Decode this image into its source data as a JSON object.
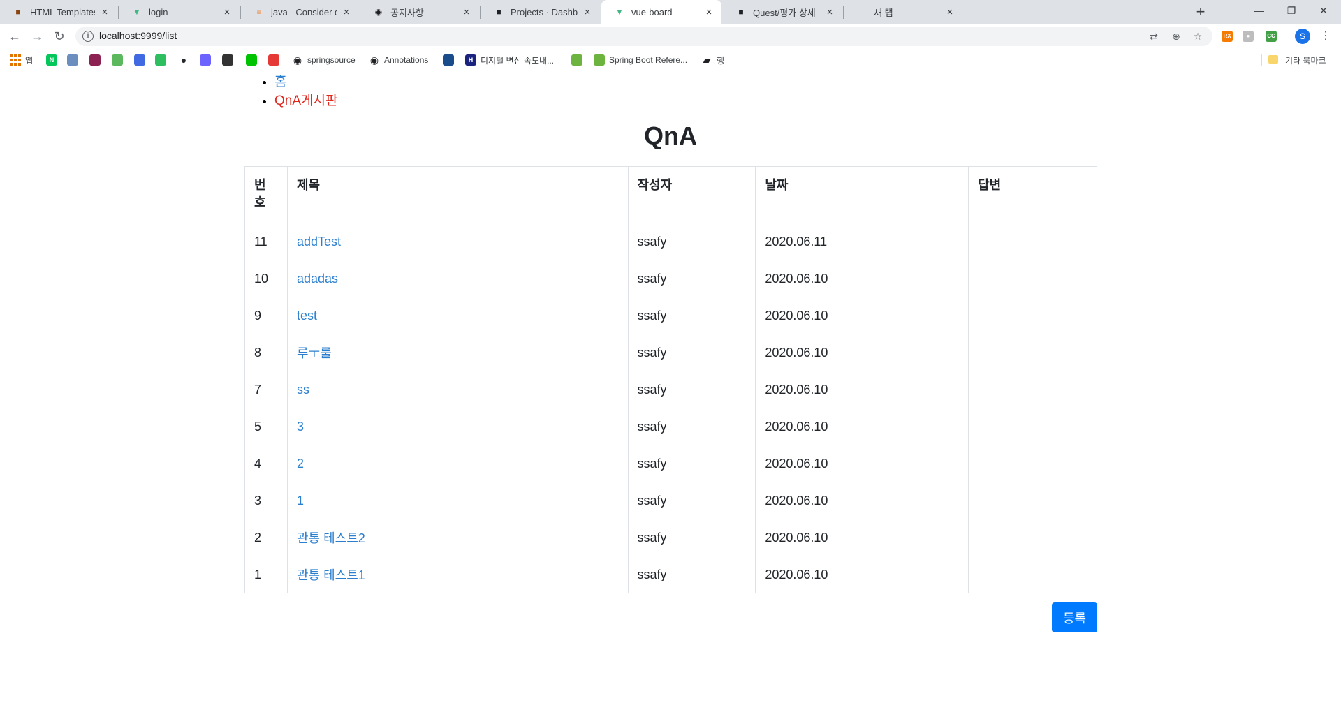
{
  "browser": {
    "tabs": [
      {
        "title": "HTML Templates - HTML W",
        "icon": "html-templates-favicon",
        "icon_color": "#8b4513"
      },
      {
        "title": "login",
        "icon": "vue-favicon",
        "icon_color": "#41b883"
      },
      {
        "title": "java - Consider defining a",
        "icon": "stackoverflow-favicon",
        "icon_color": "#f48024"
      },
      {
        "title": "공지사항",
        "icon": "globe-favicon",
        "icon_color": "#202124"
      },
      {
        "title": "Projects · Dashboard · GitL",
        "icon": "gitlab-favicon",
        "icon_color": "#202124"
      },
      {
        "title": "vue-board",
        "icon": "vue-favicon",
        "icon_color": "#41b883"
      },
      {
        "title": "Quest/평가 상세",
        "icon": "quest-favicon",
        "icon_color": "#202124"
      },
      {
        "title": "새 탭",
        "icon": "blank-favicon",
        "icon_color": "#5f6368"
      }
    ],
    "active_tab_index": 5,
    "url": "localhost:9999/list",
    "profile_initial": "S",
    "bookmarks": [
      {
        "label": "앱",
        "icon": "apps-grid-icon"
      },
      {
        "label": "",
        "icon": "naver-icon",
        "color": "#03c75a"
      },
      {
        "label": "",
        "icon": "code-brackets-icon",
        "color": "#6c8ebf"
      },
      {
        "label": "",
        "icon": "xml-icon",
        "color": "#8b2252"
      },
      {
        "label": "",
        "icon": "w3c-icon",
        "color": "#5cb85c"
      },
      {
        "label": "",
        "icon": "wave-icon",
        "color": "#4169e1"
      },
      {
        "label": "",
        "icon": "evernote-icon",
        "color": "#2dbe60"
      },
      {
        "label": "",
        "icon": "github-icon",
        "color": "#24292e"
      },
      {
        "label": "",
        "icon": "hexagon-icon",
        "color": "#6c63ff"
      },
      {
        "label": "",
        "icon": "code-tag-icon",
        "color": "#333333"
      },
      {
        "label": "",
        "icon": "line-icon",
        "color": "#00c300"
      },
      {
        "label": "",
        "icon": "pen-icon",
        "color": "#e53935"
      },
      {
        "label": "springsource",
        "icon": "globe-icon",
        "color": "#202124"
      },
      {
        "label": "Annotations",
        "icon": "globe-icon",
        "color": "#202124"
      },
      {
        "label": "",
        "icon": "mvn-icon",
        "color": "#1a4c8b"
      },
      {
        "label": "디지털 변신 속도내...",
        "icon": "h-icon",
        "color": "#1a237e"
      },
      {
        "label": "",
        "icon": "spring-icon",
        "color": "#6db33f"
      },
      {
        "label": "Spring Boot Refere...",
        "icon": "spring-icon",
        "color": "#6db33f"
      },
      {
        "label": "행",
        "icon": "book-icon",
        "color": "#202124"
      }
    ],
    "other_bookmarks": "기타 북마크"
  },
  "nav": {
    "home": "홈",
    "qna": "QnA게시판"
  },
  "page_title": "QnA",
  "table": {
    "headers": {
      "no": "번호",
      "title": "제목",
      "writer": "작성자",
      "date": "날짜",
      "answer": "답변"
    },
    "rows": [
      {
        "no": "11",
        "title": "addTest",
        "writer": "ssafy",
        "date": "2020.06.11"
      },
      {
        "no": "10",
        "title": "adadas",
        "writer": "ssafy",
        "date": "2020.06.10"
      },
      {
        "no": "9",
        "title": "test",
        "writer": "ssafy",
        "date": "2020.06.10"
      },
      {
        "no": "8",
        "title": "루ㅜ룰",
        "writer": "ssafy",
        "date": "2020.06.10"
      },
      {
        "no": "7",
        "title": "ss",
        "writer": "ssafy",
        "date": "2020.06.10"
      },
      {
        "no": "5",
        "title": "3",
        "writer": "ssafy",
        "date": "2020.06.10"
      },
      {
        "no": "4",
        "title": "2",
        "writer": "ssafy",
        "date": "2020.06.10"
      },
      {
        "no": "3",
        "title": "1",
        "writer": "ssafy",
        "date": "2020.06.10"
      },
      {
        "no": "2",
        "title": "관통 테스트2",
        "writer": "ssafy",
        "date": "2020.06.10"
      },
      {
        "no": "1",
        "title": "관통 테스트1",
        "writer": "ssafy",
        "date": "2020.06.10"
      }
    ]
  },
  "register_button": "등록",
  "colors": {
    "link": "#2c7fce",
    "active_nav": "#e1261c",
    "primary_button": "#007bff"
  }
}
